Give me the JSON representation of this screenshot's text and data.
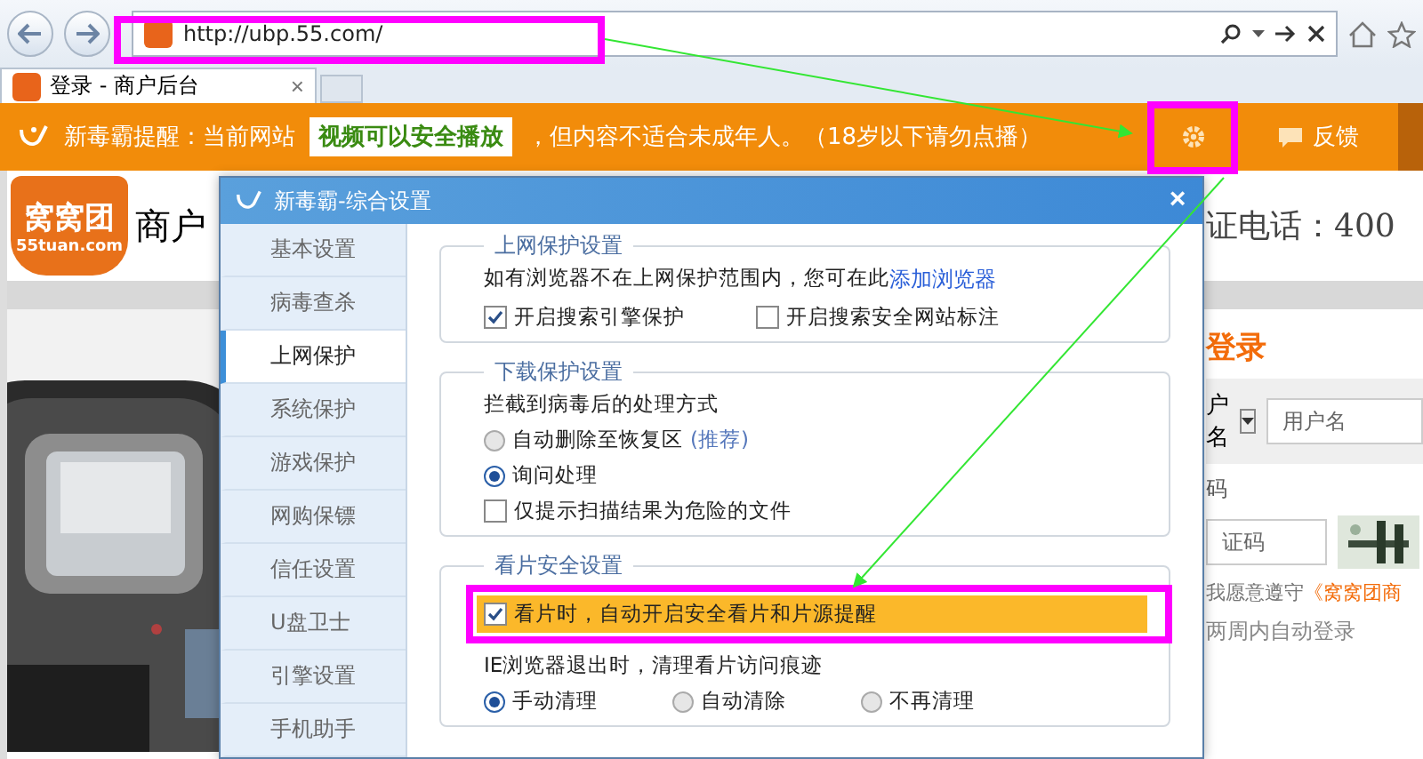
{
  "browser": {
    "url": "http://ubp.55.com/",
    "tab": {
      "title": "登录 - 商户后台",
      "close": "×"
    }
  },
  "notice_bar": {
    "prefix": "新毒霸提醒：当前网站",
    "badge": "视频可以安全播放",
    "message": "，但内容不适合未成年人。（18岁以下请勿点播）",
    "feedback": "反馈"
  },
  "page": {
    "logo_text": "窝窝团",
    "logo_domain": "55tuan.com",
    "heading": "商户",
    "phone": "证电话：400",
    "login": {
      "title": "登录",
      "account_type": "户名",
      "username_placeholder": "用户名",
      "password_label": "码",
      "captcha_placeholder": "证码",
      "agreement": "我愿意遵守",
      "agreement_link": "《窝窝团商",
      "remember": "两周内自动登录"
    }
  },
  "dialog": {
    "title": "新毒霸-综合设置",
    "close": "×",
    "sidebar": [
      {
        "label": "基本设置",
        "selected": false
      },
      {
        "label": "病毒查杀",
        "selected": false
      },
      {
        "label": "上网保护",
        "selected": true
      },
      {
        "label": "系统保护",
        "selected": false
      },
      {
        "label": "游戏保护",
        "selected": false
      },
      {
        "label": "网购保镖",
        "selected": false
      },
      {
        "label": "信任设置",
        "selected": false
      },
      {
        "label": "U盘卫士",
        "selected": false
      },
      {
        "label": "引擎设置",
        "selected": false
      },
      {
        "label": "手机助手",
        "selected": false
      }
    ],
    "sections": [
      {
        "title": "上网保护设置",
        "items": [
          {
            "kind": "text",
            "text": "如有浏览器不在上网保护范围内，您可在此",
            "link": "添加浏览器"
          },
          {
            "kind": "row",
            "options": [
              {
                "kind": "checkbox",
                "label": "开启搜索引擎保护",
                "checked": true
              },
              {
                "kind": "checkbox",
                "label": "开启搜索安全网站标注",
                "checked": false
              }
            ]
          }
        ]
      },
      {
        "title": "下载保护设置",
        "items": [
          {
            "kind": "text",
            "text": "拦截到病毒后的处理方式"
          },
          {
            "kind": "radio",
            "label": "自动删除至恢复区",
            "note": "(推荐)",
            "selected": false
          },
          {
            "kind": "radio",
            "label": "询问处理",
            "selected": true
          },
          {
            "kind": "checkbox",
            "label": "仅提示扫描结果为危险的文件",
            "checked": false
          }
        ]
      },
      {
        "title": "看片安全设置",
        "items": [
          {
            "kind": "checkbox",
            "label": "看片时，自动开启安全看片和片源提醒",
            "checked": true,
            "highlighted": true
          },
          {
            "kind": "text",
            "text": "IE浏览器退出时，清理看片访问痕迹"
          },
          {
            "kind": "row",
            "options": [
              {
                "kind": "radio",
                "label": "手动清理",
                "selected": true
              },
              {
                "kind": "radio",
                "label": "自动清除",
                "selected": false
              },
              {
                "kind": "radio",
                "label": "不再清理",
                "selected": false
              }
            ]
          }
        ]
      }
    ]
  }
}
